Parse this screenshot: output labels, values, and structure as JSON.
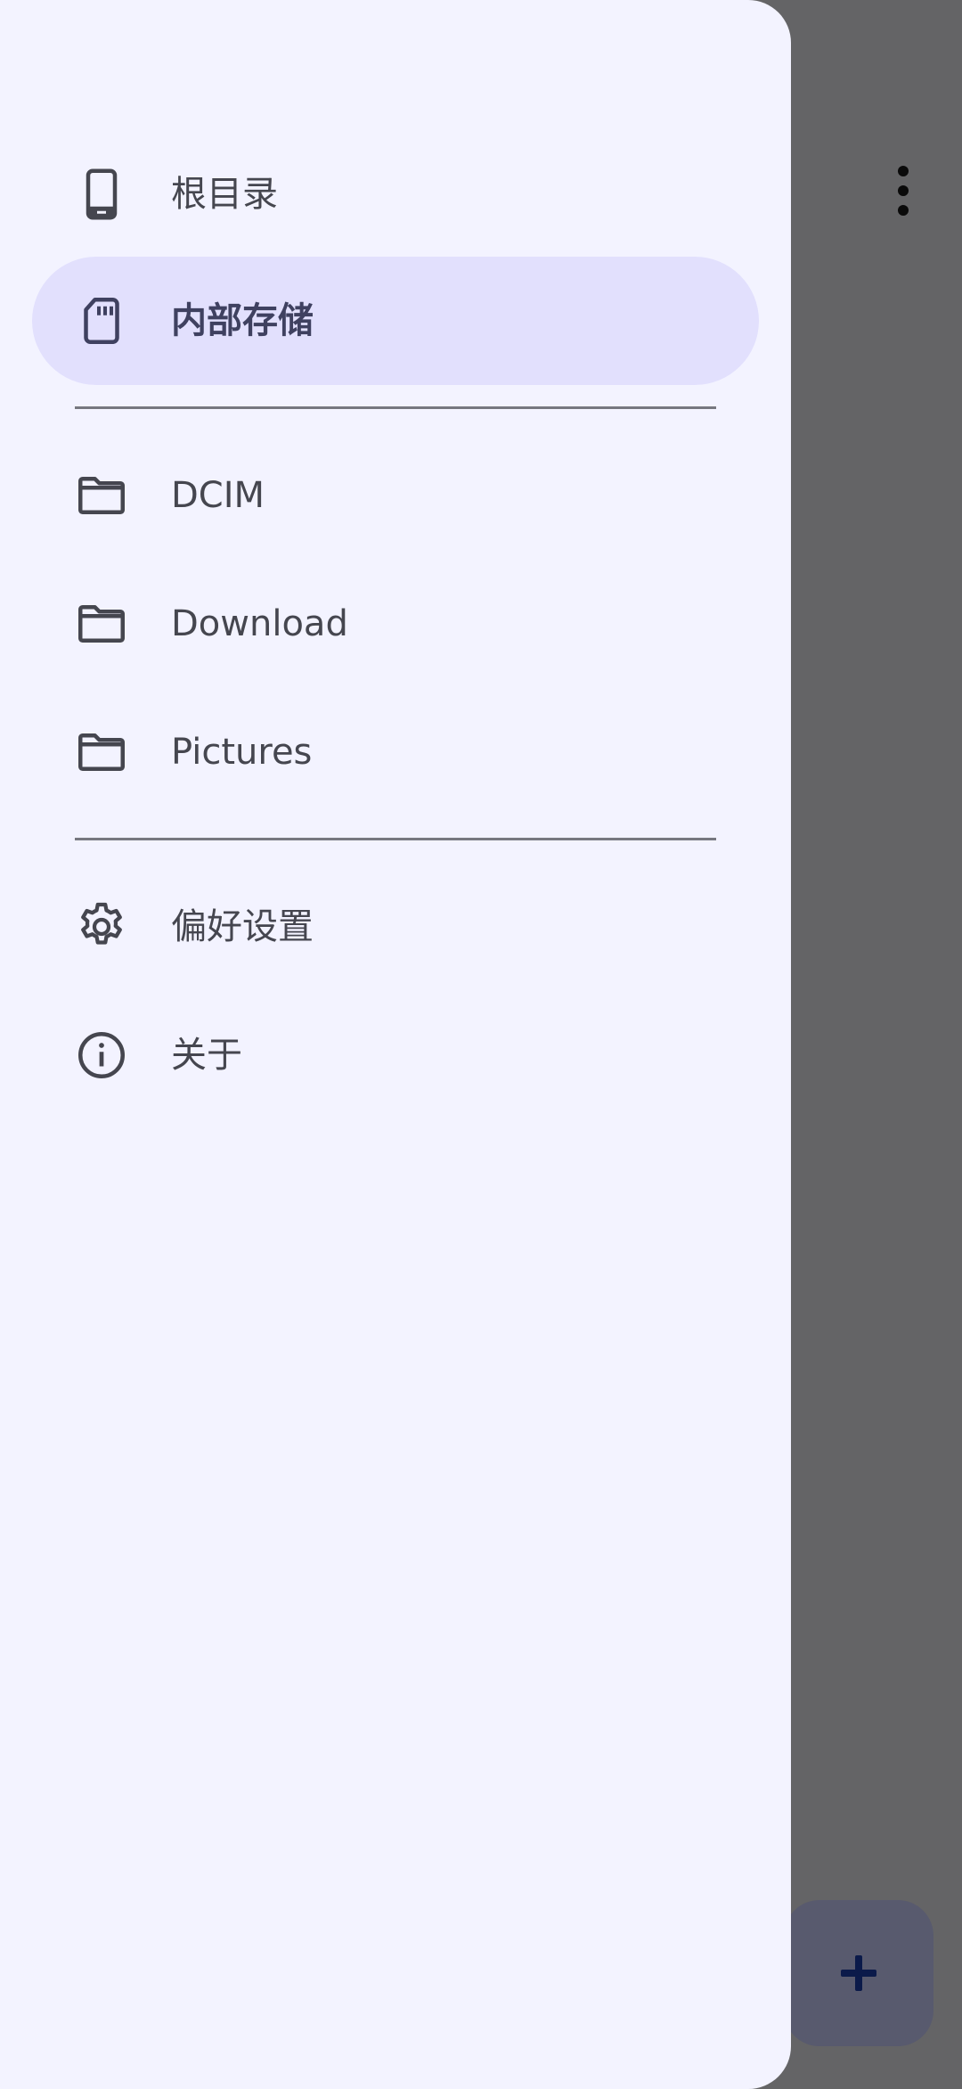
{
  "drawer": {
    "storage_items": [
      {
        "label": "根目录",
        "icon": "smartphone-icon",
        "active": false
      },
      {
        "label": "内部存储",
        "icon": "sd-card-icon",
        "active": true
      }
    ],
    "folder_items": [
      {
        "label": "DCIM",
        "icon": "folder-icon"
      },
      {
        "label": "Download",
        "icon": "folder-icon"
      },
      {
        "label": "Pictures",
        "icon": "folder-icon"
      }
    ],
    "footer_items": [
      {
        "label": "偏好设置",
        "icon": "gear-icon"
      },
      {
        "label": "关于",
        "icon": "info-icon"
      }
    ]
  },
  "app_bar": {
    "overflow_icon": "more-vert-icon"
  },
  "fab": {
    "icon": "plus-icon"
  },
  "colors": {
    "drawer_background": "#f3f3ff",
    "active_indicator": "#e2e0fd",
    "scrim": "#646466",
    "fab_background": "#585a6e",
    "fab_icon": "#0b1a4a"
  }
}
